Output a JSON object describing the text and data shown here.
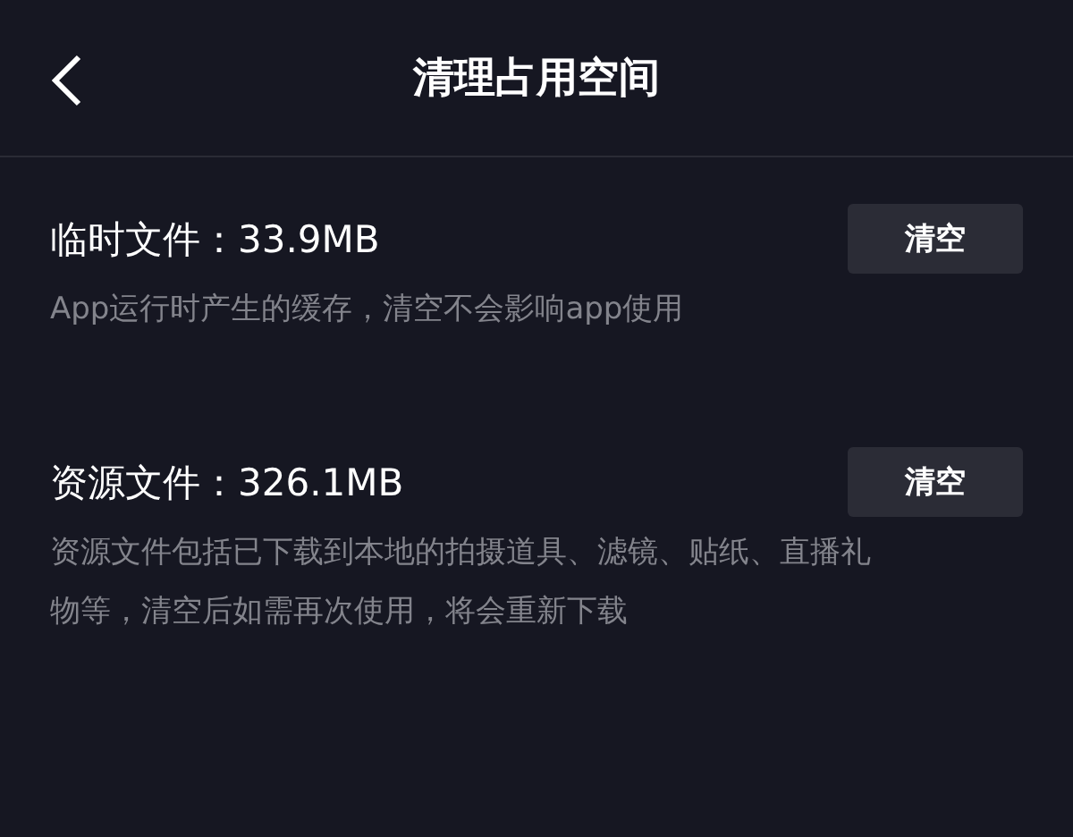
{
  "header": {
    "title": "清理占用空间"
  },
  "sections": [
    {
      "label": "临时文件：33.9MB",
      "button": "清空",
      "description": "App运行时产生的缓存，清空不会影响app使用"
    },
    {
      "label": "资源文件：326.1MB",
      "button": "清空",
      "description": "资源文件包括已下载到本地的拍摄道具、滤镜、贴纸、直播礼物等，清空后如需再次使用，将会重新下载"
    }
  ]
}
